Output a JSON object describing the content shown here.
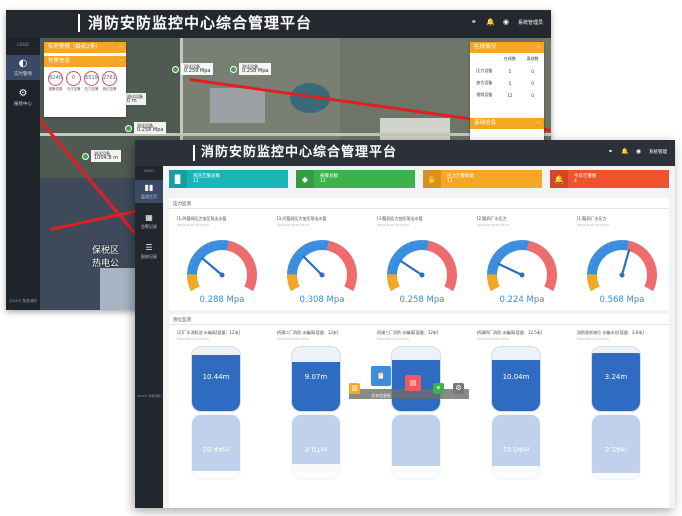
{
  "back": {
    "title": "消防安防监控中心综合管理平台",
    "header_user": "系统管理员",
    "sidebar": {
      "logo_label": "LOGO",
      "items": [
        {
          "label": "实时警情",
          "icon": "dashboard-icon"
        },
        {
          "label": "报修中心",
          "icon": "wrench-icon"
        }
      ],
      "footer": "2019©·智慧消防"
    },
    "map": {
      "watermark_line1": "保税区",
      "watermark_line2": "热电公",
      "pins": [
        {
          "name": "测试设备",
          "value": "0.259 Mpa"
        },
        {
          "name": "测试设备",
          "value": "0.258 Mpa"
        },
        {
          "name": "测试设备",
          "value": "0 m"
        },
        {
          "name": "测试设备",
          "value": "0.258 Mpa"
        },
        {
          "name": "测试设备",
          "value": "1004.8 m"
        }
      ]
    },
    "left_panel": {
      "header1": "实时警情（最新2条）",
      "header2": "告警信息",
      "counts": [
        {
          "value": "8240",
          "label": "报警总数"
        },
        {
          "value": "0",
          "label": "今日告警"
        },
        {
          "value": "5519",
          "label": "压力告警"
        },
        {
          "value": "2761",
          "label": "液位告警"
        }
      ]
    },
    "right_panel": {
      "header": "在线情况",
      "columns": [
        "",
        "在线数",
        "离线数"
      ],
      "rows": [
        [
          "压力设备",
          "5",
          "0"
        ],
        [
          "液位设备",
          "5",
          "0"
        ],
        [
          "视频设备",
          "12",
          "0"
        ]
      ],
      "header2": "基础信息"
    }
  },
  "front": {
    "title": "消防安防监控中心综合管理平台",
    "header_user": "系统管理",
    "sidebar": {
      "logo_label": "LOGO",
      "items": [
        {
          "label": "监测主页",
          "icon": "chart-icon"
        },
        {
          "label": "告警记录",
          "icon": "building-icon"
        },
        {
          "label": "报修记录",
          "icon": "list-icon"
        }
      ],
      "footer": "2019©·智慧消防"
    },
    "stats": [
      {
        "label": "液压告警总数",
        "value": "11",
        "color": "#1ab5b5",
        "icon": "bookmark-icon"
      },
      {
        "label": "报警总数",
        "value": "12",
        "color": "#3bb34a",
        "icon": "cube-icon"
      },
      {
        "label": "压力告警数量",
        "value": "11",
        "color": "#f5a623",
        "icon": "hand-icon"
      },
      {
        "label": "今日告警数",
        "value": "4",
        "color": "#f0522d",
        "icon": "bell-icon"
      }
    ],
    "pressure_section": "压力监测",
    "gauges": [
      {
        "label": "[1,9]管网压力加压泵出水管",
        "sub": "2019-09-23 09:33:20",
        "value": "0.288 Mpa",
        "needle": 0.288
      },
      {
        "label": "[3,4]管网压力加压泵出水管",
        "sub": "2019-09-23 09:33:20",
        "value": "0.308 Mpa",
        "needle": 0.308
      },
      {
        "label": "[3]管网压力加压泵出水管",
        "sub": "2019-09-23 09:33:20",
        "value": "0.258 Mpa",
        "needle": 0.258
      },
      {
        "label": "[2]管网厂水压力",
        "sub": "2019-09-23 09:33:20",
        "value": "0.224 Mpa",
        "needle": 0.224
      },
      {
        "label": "[1]管网厂水压力",
        "sub": "2019-09-23 09:33:20",
        "value": "0.568 Mpa",
        "needle": 0.568
      }
    ],
    "level_section": "液位监测",
    "levels": [
      {
        "label": "[2]厂水消防池 水箱高[容量：12米]",
        "sub": "2019-09-23 09:33:20",
        "value": "10.44m",
        "fill": 0.87
      },
      {
        "label": "桥頭二厂消防 水箱高[容量：12米]",
        "sub": "2019-09-23 09:33:20",
        "value": "9.07m",
        "fill": 0.76
      },
      {
        "label": "桥頭三厂消防 水箱高[容量：12米]",
        "sub": "2019-09-23 09:33:20",
        "value": "",
        "fill": 0.8
      },
      {
        "label": "桥頭四厂消防 水箱高[容量：12.5米]",
        "sub": "2019-09-23 09:33:20",
        "value": "10.04m",
        "fill": 0.8
      },
      {
        "label": "消防泵房液位 水箱水位[容量：3.6米]",
        "sub": "2019-09-23 09:33:20",
        "value": "3.24m",
        "fill": 0.9
      }
    ],
    "float_toolbar": {
      "label": "文本信息框"
    }
  }
}
